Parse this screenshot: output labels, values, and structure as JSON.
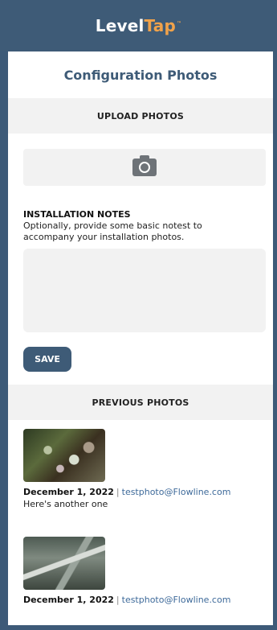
{
  "header": {
    "logo_part1": "Level",
    "logo_part2": "Tap",
    "logo_tm": "™"
  },
  "page": {
    "title": "Configuration Photos"
  },
  "upload": {
    "section_title": "UPLOAD PHOTOS",
    "camera_icon": "camera-icon"
  },
  "notes": {
    "label": "INSTALLATION NOTES",
    "help": "Optionally, provide some basic notest to accompany your installation photos.",
    "value": ""
  },
  "actions": {
    "save_label": "SAVE"
  },
  "previous": {
    "section_title": "PREVIOUS PHOTOS",
    "separator": "|",
    "items": [
      {
        "date": "December 1, 2022",
        "email": "testphoto@Flowline.com",
        "caption": "Here's another one"
      },
      {
        "date": "December 1, 2022",
        "email": "testphoto@Flowline.com",
        "caption": ""
      }
    ]
  },
  "colors": {
    "brand": "#3e5b77",
    "accent": "#f0a24a",
    "link": "#3e6a9a",
    "section_bg": "#f2f2f2"
  }
}
